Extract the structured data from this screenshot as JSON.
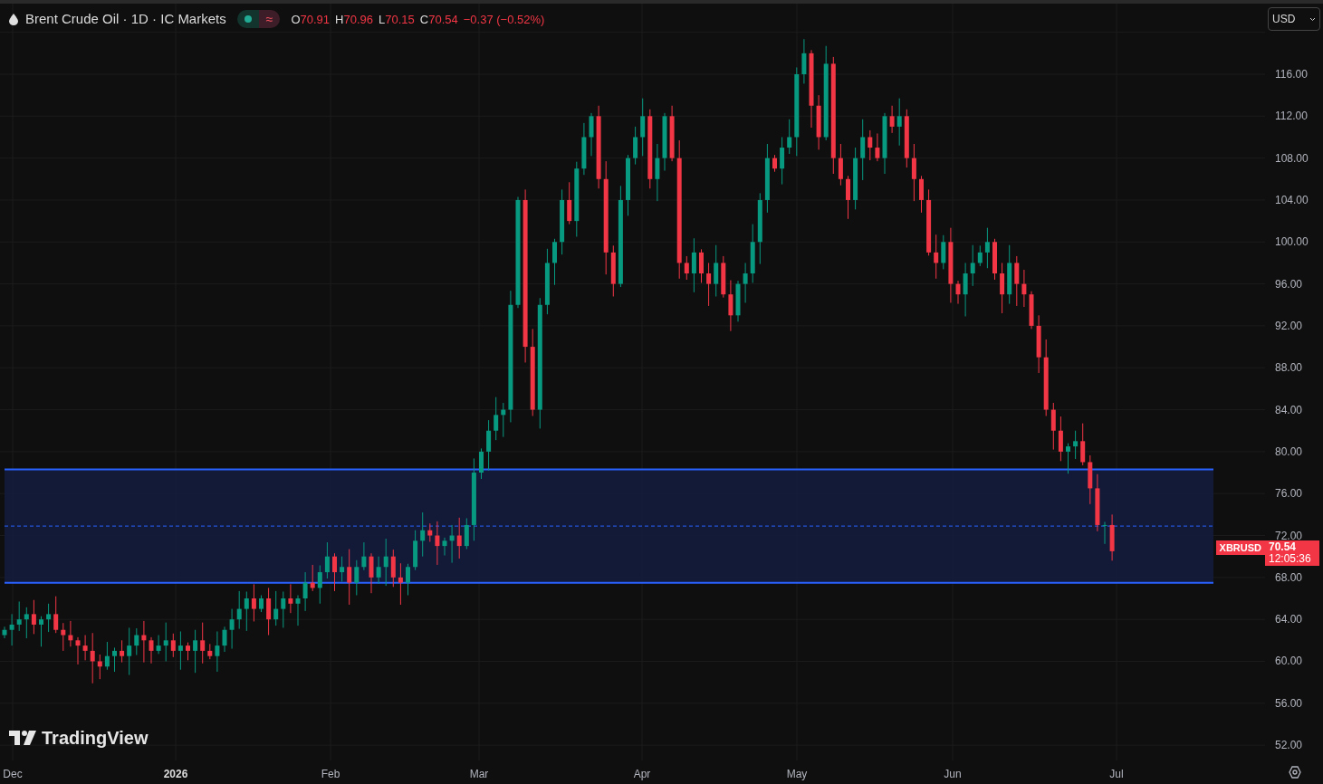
{
  "legend": {
    "title": "Brent Crude Oil · 1D · IC Markets",
    "indicator_symbol": "≈",
    "ohlc": [
      {
        "label": "O",
        "value": "70.91"
      },
      {
        "label": "H",
        "value": "70.96"
      },
      {
        "label": "L",
        "value": "70.15"
      },
      {
        "label": "C",
        "value": "70.54"
      }
    ],
    "change": "−0.37 (−0.52%)"
  },
  "currency": "USD",
  "price_scale": {
    "ticks": [
      "116.00",
      "112.00",
      "108.00",
      "104.00",
      "100.00",
      "96.00",
      "92.00",
      "88.00",
      "84.00",
      "80.00",
      "76.00",
      "72.00",
      "68.00",
      "64.00",
      "60.00",
      "56.00",
      "52.00"
    ]
  },
  "last_price": {
    "symbol": "XBRUSD",
    "price": "70.54",
    "countdown": "12:05:36"
  },
  "time_axis": {
    "labels": [
      "Dec",
      "2026",
      "Feb",
      "Mar",
      "Apr",
      "May",
      "Jun",
      "Jul"
    ]
  },
  "logo": {
    "text": "TradingView"
  }
}
